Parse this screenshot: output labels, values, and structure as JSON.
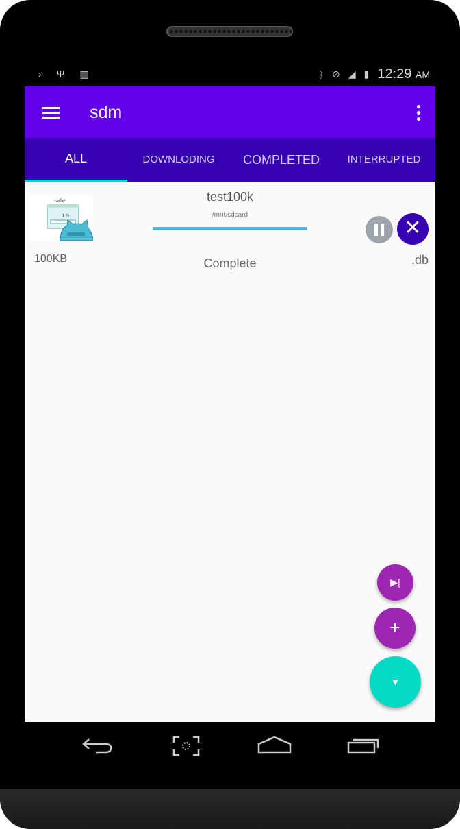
{
  "status_bar": {
    "time": "12:29",
    "ampm": "AM"
  },
  "app_bar": {
    "title": "sdm"
  },
  "tabs": [
    {
      "label": "ALL"
    },
    {
      "label": "DOWNLODING"
    },
    {
      "label": "COMPLETED"
    },
    {
      "label": "INTERRUPTED"
    }
  ],
  "downloads": [
    {
      "name": "test100k",
      "path": "/mnt/sdcard",
      "size": "100KB",
      "status": "Complete",
      "extension": ".db",
      "progress": 1.0
    }
  ],
  "colors": {
    "primary": "#6200ea",
    "primary_dark": "#3700b3",
    "accent": "#03dac5",
    "fab": "#9c27b0"
  }
}
